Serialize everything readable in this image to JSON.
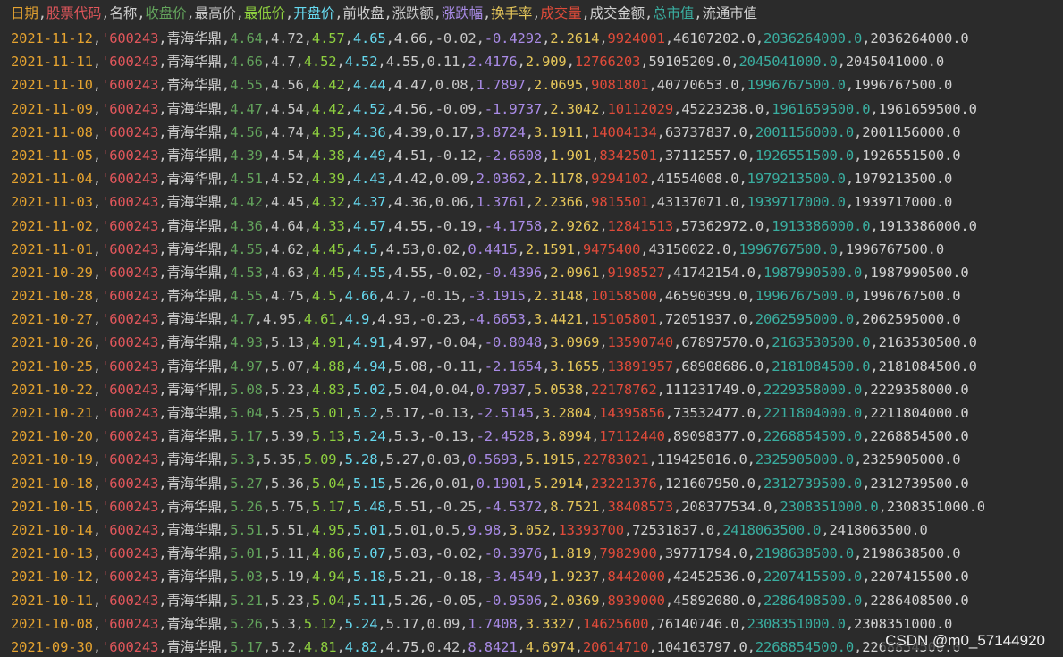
{
  "header": [
    "日期",
    "股票代码",
    "名称",
    "收盘价",
    "最高价",
    "最低价",
    "开盘价",
    "前收盘",
    "涨跌额",
    "涨跌幅",
    "换手率",
    "成交量",
    "成交金额",
    "总市值",
    "流通市值"
  ],
  "rows": [
    [
      "2021-11-12",
      "'600243",
      "青海华鼎",
      "4.64",
      "4.72",
      "4.57",
      "4.65",
      "4.66",
      "-0.02",
      "-0.4292",
      "2.2614",
      "9924001",
      "46107202.0",
      "2036264000.0",
      "2036264000.0"
    ],
    [
      "2021-11-11",
      "'600243",
      "青海华鼎",
      "4.66",
      "4.7",
      "4.52",
      "4.52",
      "4.55",
      "0.11",
      "2.4176",
      "2.909",
      "12766203",
      "59105209.0",
      "2045041000.0",
      "2045041000.0"
    ],
    [
      "2021-11-10",
      "'600243",
      "青海华鼎",
      "4.55",
      "4.56",
      "4.42",
      "4.44",
      "4.47",
      "0.08",
      "1.7897",
      "2.0695",
      "9081801",
      "40770653.0",
      "1996767500.0",
      "1996767500.0"
    ],
    [
      "2021-11-09",
      "'600243",
      "青海华鼎",
      "4.47",
      "4.54",
      "4.42",
      "4.52",
      "4.56",
      "-0.09",
      "-1.9737",
      "2.3042",
      "10112029",
      "45223238.0",
      "1961659500.0",
      "1961659500.0"
    ],
    [
      "2021-11-08",
      "'600243",
      "青海华鼎",
      "4.56",
      "4.74",
      "4.35",
      "4.36",
      "4.39",
      "0.17",
      "3.8724",
      "3.1911",
      "14004134",
      "63737837.0",
      "2001156000.0",
      "2001156000.0"
    ],
    [
      "2021-11-05",
      "'600243",
      "青海华鼎",
      "4.39",
      "4.54",
      "4.38",
      "4.49",
      "4.51",
      "-0.12",
      "-2.6608",
      "1.901",
      "8342501",
      "37112557.0",
      "1926551500.0",
      "1926551500.0"
    ],
    [
      "2021-11-04",
      "'600243",
      "青海华鼎",
      "4.51",
      "4.52",
      "4.39",
      "4.43",
      "4.42",
      "0.09",
      "2.0362",
      "2.1178",
      "9294102",
      "41554008.0",
      "1979213500.0",
      "1979213500.0"
    ],
    [
      "2021-11-03",
      "'600243",
      "青海华鼎",
      "4.42",
      "4.45",
      "4.32",
      "4.37",
      "4.36",
      "0.06",
      "1.3761",
      "2.2366",
      "9815501",
      "43137071.0",
      "1939717000.0",
      "1939717000.0"
    ],
    [
      "2021-11-02",
      "'600243",
      "青海华鼎",
      "4.36",
      "4.64",
      "4.33",
      "4.57",
      "4.55",
      "-0.19",
      "-4.1758",
      "2.9262",
      "12841513",
      "57362972.0",
      "1913386000.0",
      "1913386000.0"
    ],
    [
      "2021-11-01",
      "'600243",
      "青海华鼎",
      "4.55",
      "4.62",
      "4.45",
      "4.5",
      "4.53",
      "0.02",
      "0.4415",
      "2.1591",
      "9475400",
      "43150022.0",
      "1996767500.0",
      "1996767500.0"
    ],
    [
      "2021-10-29",
      "'600243",
      "青海华鼎",
      "4.53",
      "4.63",
      "4.45",
      "4.55",
      "4.55",
      "-0.02",
      "-0.4396",
      "2.0961",
      "9198527",
      "41742154.0",
      "1987990500.0",
      "1987990500.0"
    ],
    [
      "2021-10-28",
      "'600243",
      "青海华鼎",
      "4.55",
      "4.75",
      "4.5",
      "4.66",
      "4.7",
      "-0.15",
      "-3.1915",
      "2.3148",
      "10158500",
      "46590399.0",
      "1996767500.0",
      "1996767500.0"
    ],
    [
      "2021-10-27",
      "'600243",
      "青海华鼎",
      "4.7",
      "4.95",
      "4.61",
      "4.9",
      "4.93",
      "-0.23",
      "-4.6653",
      "3.4421",
      "15105801",
      "72051937.0",
      "2062595000.0",
      "2062595000.0"
    ],
    [
      "2021-10-26",
      "'600243",
      "青海华鼎",
      "4.93",
      "5.13",
      "4.91",
      "4.91",
      "4.97",
      "-0.04",
      "-0.8048",
      "3.0969",
      "13590740",
      "67897570.0",
      "2163530500.0",
      "2163530500.0"
    ],
    [
      "2021-10-25",
      "'600243",
      "青海华鼎",
      "4.97",
      "5.07",
      "4.88",
      "4.94",
      "5.08",
      "-0.11",
      "-2.1654",
      "3.1655",
      "13891957",
      "68908686.0",
      "2181084500.0",
      "2181084500.0"
    ],
    [
      "2021-10-22",
      "'600243",
      "青海华鼎",
      "5.08",
      "5.23",
      "4.83",
      "5.02",
      "5.04",
      "0.04",
      "0.7937",
      "5.0538",
      "22178762",
      "111231749.0",
      "2229358000.0",
      "2229358000.0"
    ],
    [
      "2021-10-21",
      "'600243",
      "青海华鼎",
      "5.04",
      "5.25",
      "5.01",
      "5.2",
      "5.17",
      "-0.13",
      "-2.5145",
      "3.2804",
      "14395856",
      "73532477.0",
      "2211804000.0",
      "2211804000.0"
    ],
    [
      "2021-10-20",
      "'600243",
      "青海华鼎",
      "5.17",
      "5.39",
      "5.13",
      "5.24",
      "5.3",
      "-0.13",
      "-2.4528",
      "3.8994",
      "17112440",
      "89098377.0",
      "2268854500.0",
      "2268854500.0"
    ],
    [
      "2021-10-19",
      "'600243",
      "青海华鼎",
      "5.3",
      "5.35",
      "5.09",
      "5.28",
      "5.27",
      "0.03",
      "0.5693",
      "5.1915",
      "22783021",
      "119425016.0",
      "2325905000.0",
      "2325905000.0"
    ],
    [
      "2021-10-18",
      "'600243",
      "青海华鼎",
      "5.27",
      "5.36",
      "5.04",
      "5.15",
      "5.26",
      "0.01",
      "0.1901",
      "5.2914",
      "23221376",
      "121607950.0",
      "2312739500.0",
      "2312739500.0"
    ],
    [
      "2021-10-15",
      "'600243",
      "青海华鼎",
      "5.26",
      "5.75",
      "5.17",
      "5.48",
      "5.51",
      "-0.25",
      "-4.5372",
      "8.7521",
      "38408573",
      "208377534.0",
      "2308351000.0",
      "2308351000.0"
    ],
    [
      "2021-10-14",
      "'600243",
      "青海华鼎",
      "5.51",
      "5.51",
      "4.95",
      "5.01",
      "5.01",
      "0.5",
      "9.98",
      "3.052",
      "13393700",
      "72531837.0",
      "2418063500.0",
      "2418063500.0"
    ],
    [
      "2021-10-13",
      "'600243",
      "青海华鼎",
      "5.01",
      "5.11",
      "4.86",
      "5.07",
      "5.03",
      "-0.02",
      "-0.3976",
      "1.819",
      "7982900",
      "39771794.0",
      "2198638500.0",
      "2198638500.0"
    ],
    [
      "2021-10-12",
      "'600243",
      "青海华鼎",
      "5.03",
      "5.19",
      "4.94",
      "5.18",
      "5.21",
      "-0.18",
      "-3.4549",
      "1.9237",
      "8442000",
      "42452536.0",
      "2207415500.0",
      "2207415500.0"
    ],
    [
      "2021-10-11",
      "'600243",
      "青海华鼎",
      "5.21",
      "5.23",
      "5.04",
      "5.11",
      "5.26",
      "-0.05",
      "-0.9506",
      "2.0369",
      "8939000",
      "45892080.0",
      "2286408500.0",
      "2286408500.0"
    ],
    [
      "2021-10-08",
      "'600243",
      "青海华鼎",
      "5.26",
      "5.3",
      "5.12",
      "5.24",
      "5.17",
      "0.09",
      "1.7408",
      "3.3327",
      "14625600",
      "76140746.0",
      "2308351000.0",
      "2308351000.0"
    ],
    [
      "2021-09-30",
      "'600243",
      "青海华鼎",
      "5.17",
      "5.2",
      "4.81",
      "4.82",
      "4.75",
      "0.42",
      "8.8421",
      "4.6974",
      "20614710",
      "104163797.0",
      "2268854500.0",
      "2268854500.0"
    ]
  ],
  "column_classes": [
    "c-date",
    "c-code",
    "c-name",
    "c-close",
    "c-high",
    "c-low",
    "c-open",
    "c-prev",
    "c-chg",
    "c-pct",
    "c-turn",
    "c-vol",
    "c-amt",
    "c-mcap",
    "c-float"
  ],
  "watermark": "CSDN @m0_57144920"
}
